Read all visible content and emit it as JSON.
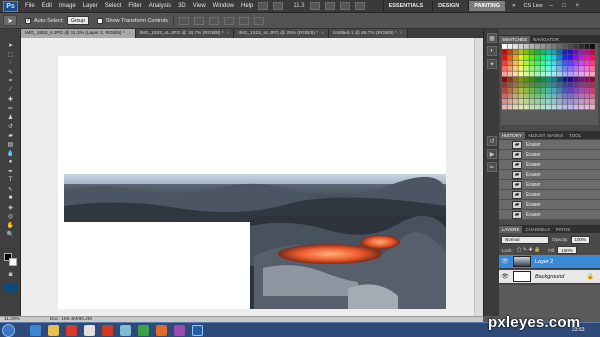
{
  "app": {
    "logo": "Ps"
  },
  "menu": [
    "File",
    "Edit",
    "Image",
    "Layer",
    "Select",
    "Filter",
    "Analysis",
    "3D",
    "View",
    "Window",
    "Help"
  ],
  "zoom_readout": "11.3",
  "workspaces": [
    {
      "label": "ESSENTIALS",
      "active": false
    },
    {
      "label": "DESIGN",
      "active": false
    },
    {
      "label": "PAINTING",
      "active": true
    }
  ],
  "cs_live": "CS Live",
  "window_controls": [
    "–",
    "□",
    "×"
  ],
  "options": {
    "auto_select_label": "Auto-Select:",
    "auto_select_value": "Group",
    "transform_label": "Show Transform Controls"
  },
  "doc_tabs": [
    {
      "label": "IMG_1553_s.JPG @ 11.3% (Layer 2, RGB/8) *",
      "active": true
    },
    {
      "label": "IMG_1503_sL.JPG @ 16.7% (RGB/8) *",
      "active": false
    },
    {
      "label": "IMG_1515_sc.JPG @ 25% (RGB/8) *",
      "active": false
    },
    {
      "label": "Untitled-1 @ 66.7% (RGB/8) *",
      "active": false
    }
  ],
  "status": {
    "zoom": "11.29%",
    "doc": "Doc: 106.4M/80.2M"
  },
  "panels": {
    "swatch_tabs": [
      "SWATCHES",
      "NAVIGATOR"
    ],
    "history_tabs": [
      "HISTORY",
      "ADJUST. MASKS",
      "TOOL"
    ],
    "history_items": [
      "Eraser",
      "Eraser",
      "Eraser",
      "Eraser",
      "Eraser",
      "Eraser",
      "Eraser",
      "Eraser"
    ],
    "layer_tabs": [
      "LAYERS",
      "CHANNELS",
      "PATHS"
    ],
    "blend_mode": "Normal",
    "opacity_label": "Opacity:",
    "opacity_value": "100%",
    "lock_label": "Lock:",
    "fill_label": "Fill:",
    "fill_value": "100%",
    "layers": [
      {
        "name": "Layer 2",
        "selected": true
      },
      {
        "name": "Background",
        "selected": false
      }
    ]
  },
  "taskbar": {
    "clock": "23:53"
  },
  "watermark": "pxleyes.com"
}
